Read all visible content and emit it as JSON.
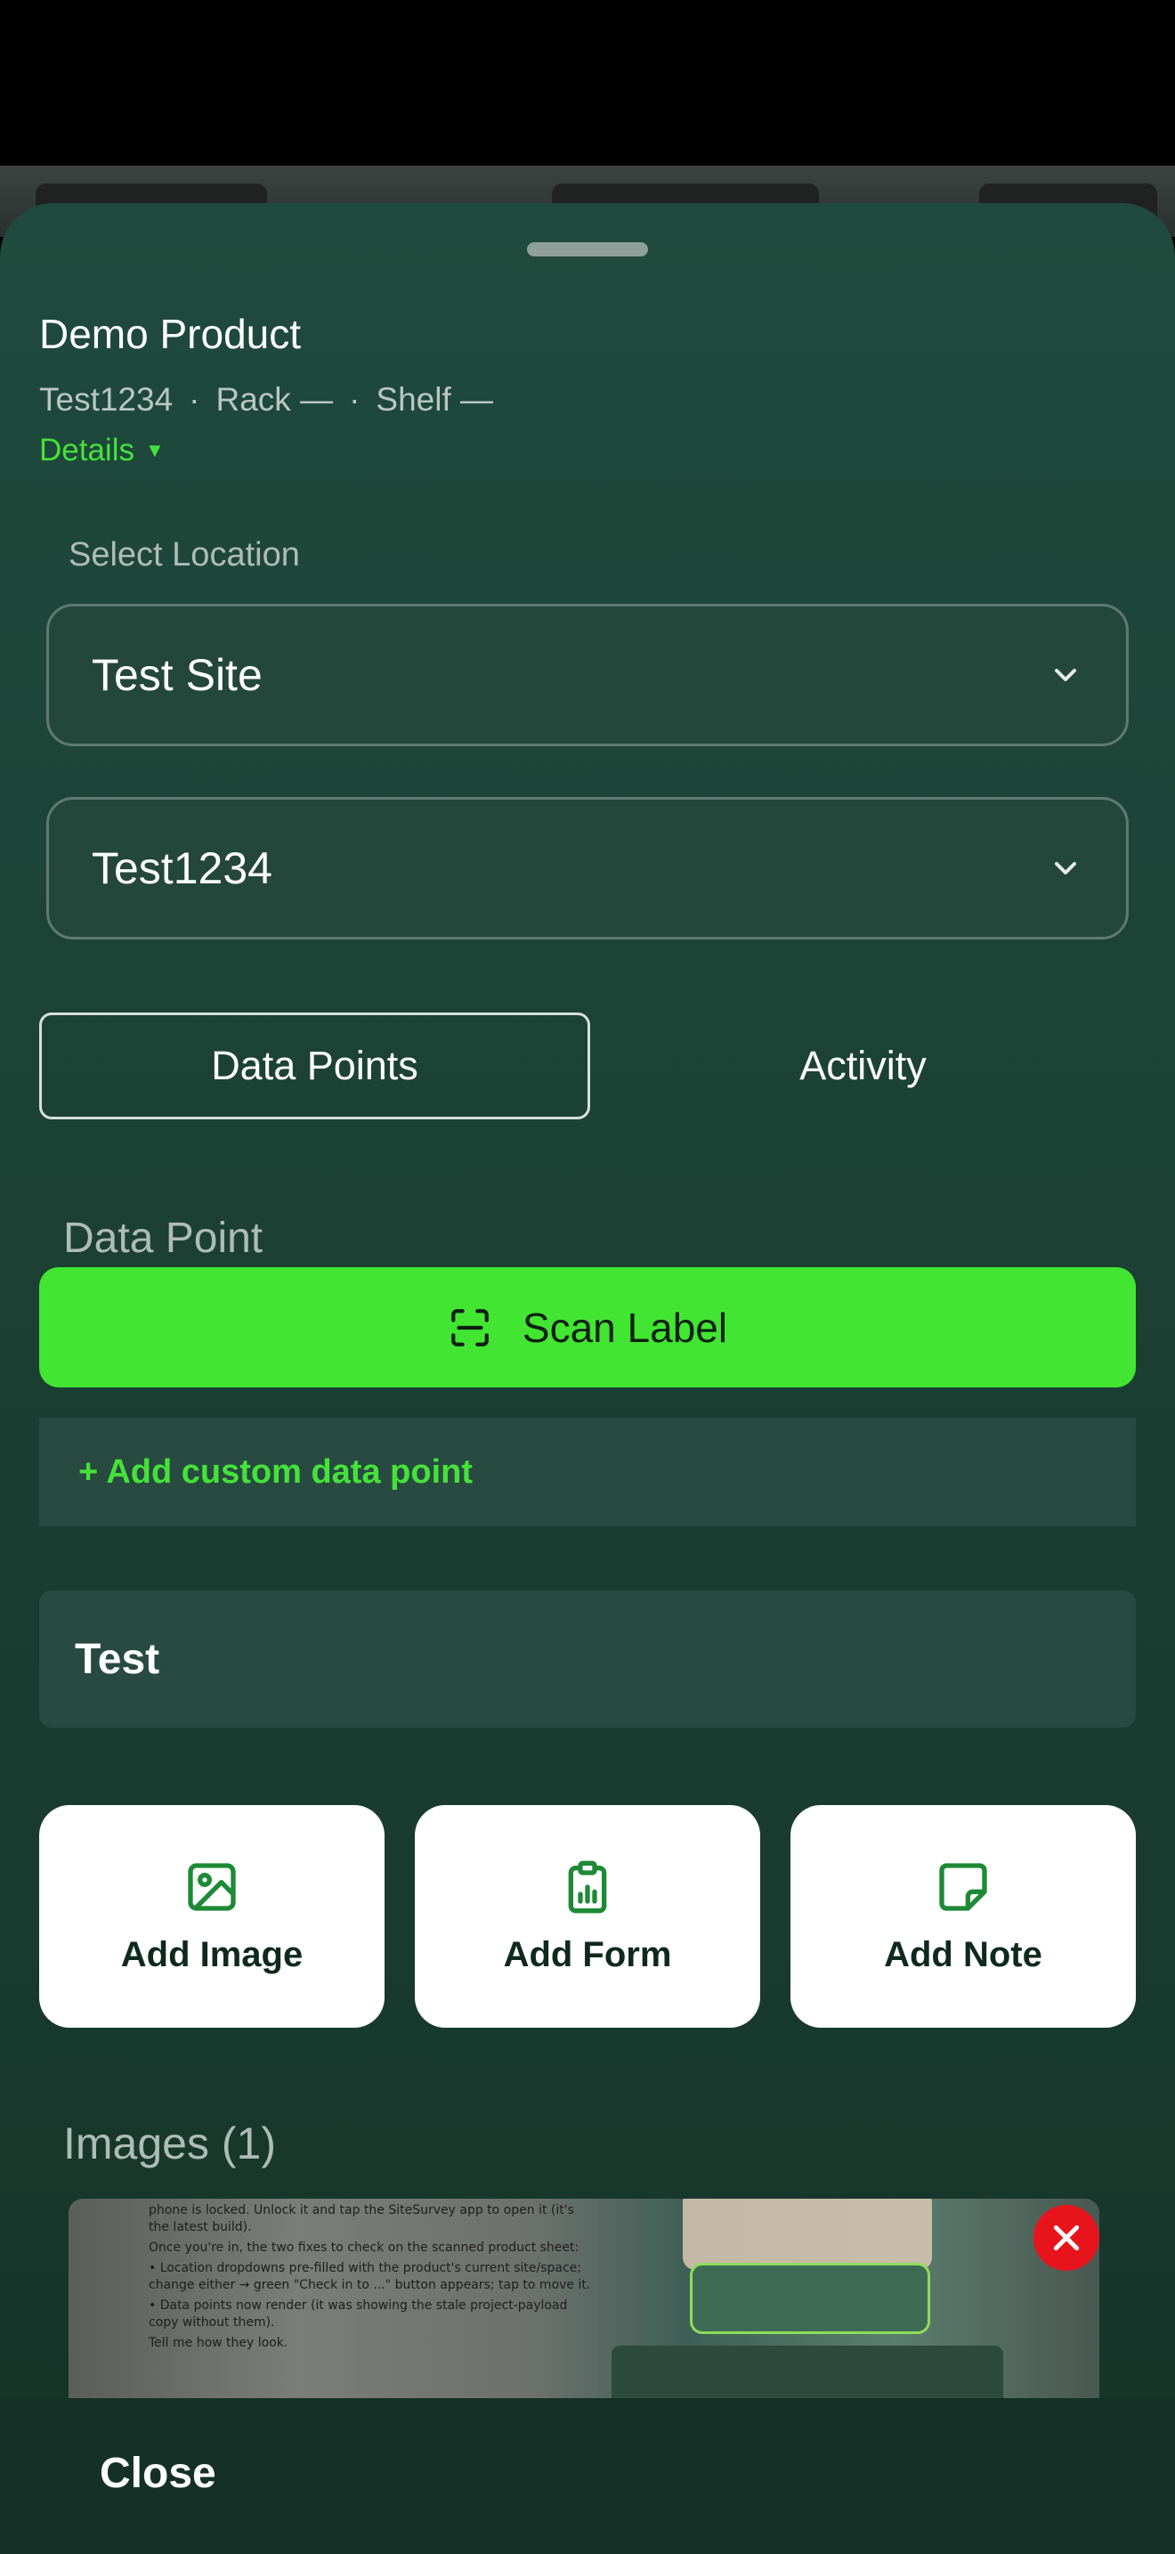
{
  "product": {
    "name": "Demo Product",
    "code": "Test1234",
    "rack": "Rack —",
    "shelf": "Shelf —",
    "separator": "·",
    "details_label": "Details",
    "details_caret": "▼"
  },
  "location": {
    "section_label": "Select Location",
    "site_value": "Test Site",
    "space_value": "Test1234"
  },
  "tabs": [
    {
      "label": "Data Points",
      "active": true
    },
    {
      "label": "Activity",
      "active": false
    }
  ],
  "data_point": {
    "section_label": "Data Point",
    "scan_label": "Scan Label",
    "add_custom_label": "+ Add custom data point",
    "field_value": "Test"
  },
  "actions": [
    {
      "label": "Add Image",
      "icon": "image-icon"
    },
    {
      "label": "Add Form",
      "icon": "clipboard-chart-icon"
    },
    {
      "label": "Add Note",
      "icon": "sticky-note-icon"
    }
  ],
  "images": {
    "section_label": "Images (1)",
    "thumbnail_text": [
      "phone is locked. Unlock it and tap the SiteSurvey app to open it (it's the latest build).",
      "Once you're in, the two fixes to check on the scanned product sheet:",
      "• Location dropdowns pre-filled with the product's current site/space; change either → green \"Check in to ...\" button appears; tap to move it.",
      "• Data points now render (it was showing the stale project-payload copy without them).",
      "Tell me how they look."
    ]
  },
  "footer": {
    "close_label": "Close"
  },
  "colors": {
    "accent_green": "#42e532",
    "sheet_bg": "#1f4a3d",
    "remove_red": "#e8141c"
  }
}
